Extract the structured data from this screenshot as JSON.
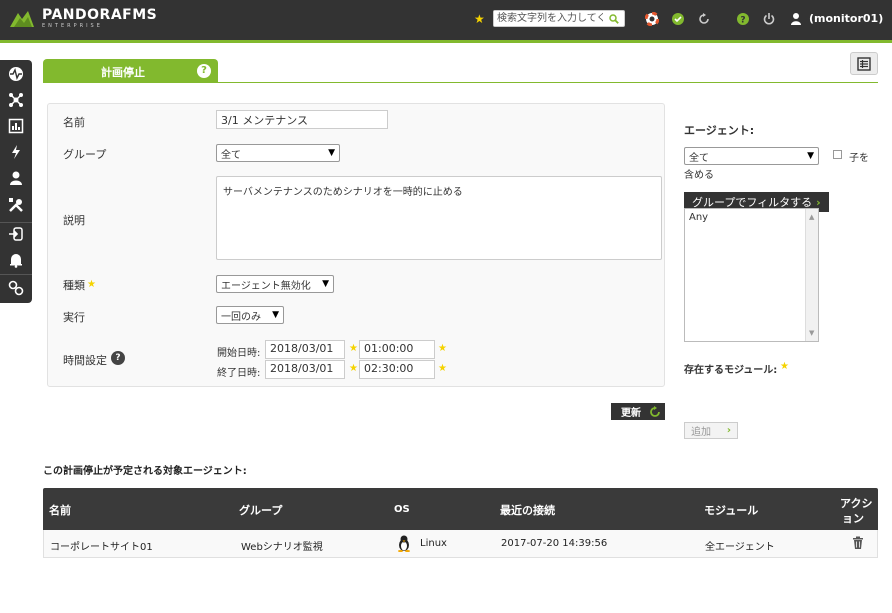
{
  "header": {
    "logo_text": "PANDORAFMS",
    "logo_sub": "ENTERPRISE",
    "search_placeholder": "検索文字列を入力してください",
    "user": "(monitor01)",
    "icons": [
      "star-icon",
      "search-icon",
      "lifebuoy-icon",
      "check-icon",
      "refresh-icon",
      "help-icon",
      "power-icon",
      "user-icon"
    ]
  },
  "sidebar": {
    "icons": [
      "monitoring-icon",
      "topology-icon",
      "reports-icon",
      "events-icon",
      "user-icon",
      "tools-icon",
      "login-icon",
      "bell-icon",
      "links-icon"
    ]
  },
  "tab": {
    "label": "計画停止",
    "help": "?"
  },
  "form": {
    "name_label": "名前",
    "name_value": "3/1 メンテナンス",
    "group_label": "グループ",
    "group_value": "全て",
    "description_label": "説明",
    "description_value": "サーバメンテナンスのためシナリオを一時的に止める",
    "type_label": "種類",
    "type_value": "エージェント無効化",
    "execution_label": "実行",
    "execution_value": "一回のみ",
    "time_label": "時間設定",
    "start_label": "開始日時:",
    "start_date": "2018/03/01",
    "start_time": "01:00:00",
    "end_label": "終了日時:",
    "end_date": "2018/03/01",
    "end_time": "02:30:00",
    "update_button": "更新"
  },
  "right": {
    "agents_label": "エージェント:",
    "group_select": "全て",
    "include_children_a": "子を",
    "include_children_b": "含める",
    "filter_button": "グループでフィルタする",
    "agent_list": [
      "Any"
    ],
    "modules_label": "存在するモジュール:",
    "add_button": "追加"
  },
  "table": {
    "title": "この計画停止が予定される対象エージェント:",
    "headers": {
      "name": "名前",
      "group": "グループ",
      "os": "OS",
      "last_contact": "最近の接続",
      "module": "モジュール",
      "action_a": "アクシ",
      "action_b": "ョン"
    },
    "rows": [
      {
        "name": "コーポレートサイト01",
        "group": "Webシナリオ監視",
        "os": "Linux",
        "last_contact": "2017-07-20 14:39:56",
        "module": "全エージェント"
      }
    ]
  },
  "colors": {
    "accent": "#82b92e",
    "header_bg": "#333333",
    "star": "#f5d300"
  }
}
